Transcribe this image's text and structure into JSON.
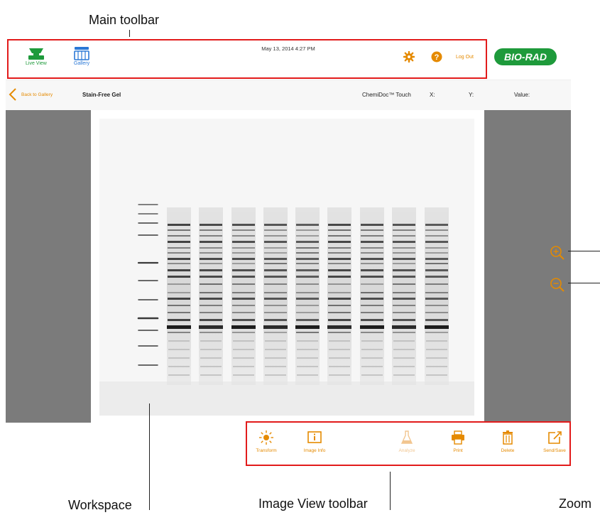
{
  "callouts": {
    "main_toolbar": "Main toolbar",
    "workspace": "Workspace",
    "image_view_toolbar": "Image View toolbar",
    "zoom": "Zoom"
  },
  "main_toolbar": {
    "live_view_label": "Live View",
    "gallery_label": "Gallery",
    "datetime": "May 13, 2014 4:27 PM",
    "logout_label": "Log Out",
    "brand_logo_text": "BIO-RAD"
  },
  "sub_bar": {
    "back_label": "Back to Gallery",
    "image_title": "Stain-Free Gel",
    "instrument": "ChemiDoc™ Touch",
    "x_label": "X:",
    "y_label": "Y:",
    "value_label": "Value:"
  },
  "image_view_toolbar": {
    "items": [
      {
        "label": "Transform",
        "icon": "sun-icon",
        "enabled": true
      },
      {
        "label": "Image Info",
        "icon": "info-icon",
        "enabled": true
      },
      {
        "label": "Analyze",
        "icon": "flask-icon",
        "enabled": false
      },
      {
        "label": "Print",
        "icon": "printer-icon",
        "enabled": true
      },
      {
        "label": "Delete",
        "icon": "trash-icon",
        "enabled": true
      },
      {
        "label": "Send/Save",
        "icon": "share-icon",
        "enabled": true
      }
    ]
  },
  "colors": {
    "accent": "#e58a00",
    "brand_green": "#1e9a3b",
    "highlight_red": "#e21b1b",
    "gallery_blue": "#2a78d6",
    "side_panel": "#7b7b7b"
  }
}
